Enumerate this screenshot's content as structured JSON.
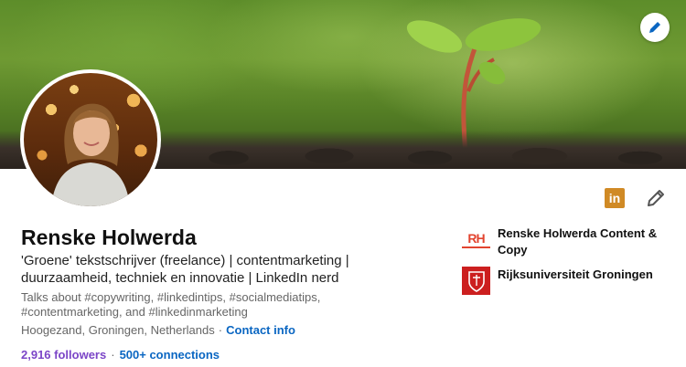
{
  "profile": {
    "name": "Renske Holwerda",
    "headline": "'Groene' tekstschrijver (freelance) | contentmarketing | duurzaamheid, techniek en innovatie | LinkedIn nerd",
    "talks_about": "Talks about #copywriting, #linkedintips, #socialmediatips, #contentmarketing, and #linkedinmarketing",
    "location": "Hoogezand, Groningen, Netherlands",
    "separator": "·",
    "contact_info_label": "Contact info",
    "followers": "2,916 followers",
    "connections": "500+ connections"
  },
  "organizations": [
    {
      "logo_text": "RH",
      "name": "Renske Holwerda Content & Copy"
    },
    {
      "logo_text": "",
      "name": "Rijksuniversiteit Groningen"
    }
  ],
  "icons": {
    "cover_edit": "pencil-icon",
    "linkedin": "linkedin-icon",
    "edit_intro": "pencil-icon"
  },
  "linkedin_badge": "in",
  "colors": {
    "link_blue": "#0a66c2",
    "followers_purple": "#7b45c7",
    "linkedin_orange": "#d08a25",
    "rh_red": "#e2442f",
    "rug_red": "#cc1f1f"
  }
}
